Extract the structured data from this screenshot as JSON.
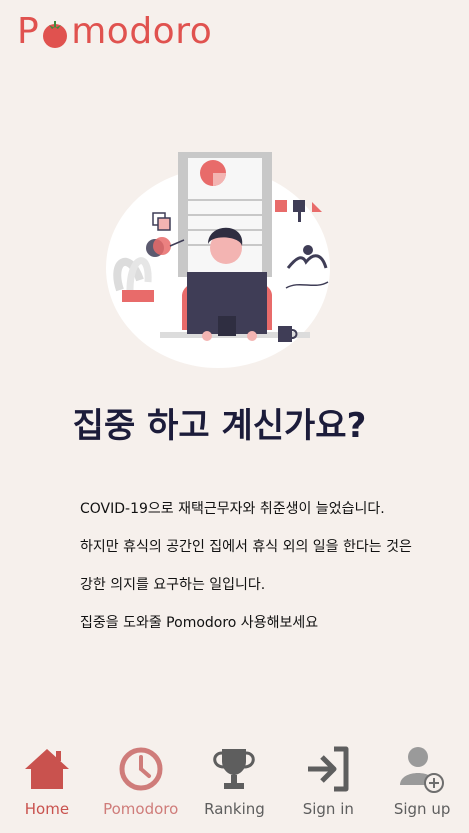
{
  "app": {
    "logo_text_start": "P",
    "logo_text_end": "modoro"
  },
  "hero": {
    "headline": "집중 하고 계신가요?",
    "paragraphs": [
      "COVID-19으로 재택근무자와 취준생이 늘었습니다.",
      "하지만 휴식의 공간인 집에서 휴식 외의 일을 한다는 것은",
      "강한 의지를 요구하는 일입니다.",
      "집중을 도와줄 Pomodoro 사용해보세요"
    ]
  },
  "nav": {
    "items": [
      {
        "label": "Home",
        "icon": "home-icon",
        "color": "#c9524e"
      },
      {
        "label": "Pomodoro",
        "icon": "clock-icon",
        "color": "#cf7c7a"
      },
      {
        "label": "Ranking",
        "icon": "trophy-icon",
        "color": "#5e5e5e"
      },
      {
        "label": "Sign in",
        "icon": "sign-in-icon",
        "color": "#5e5e5e"
      },
      {
        "label": "Sign up",
        "icon": "add-user-icon",
        "color": "#5e5e5e"
      }
    ]
  },
  "colors": {
    "background": "#f6f0ec",
    "brand": "#e0524f",
    "headline": "#1c1c3a"
  }
}
